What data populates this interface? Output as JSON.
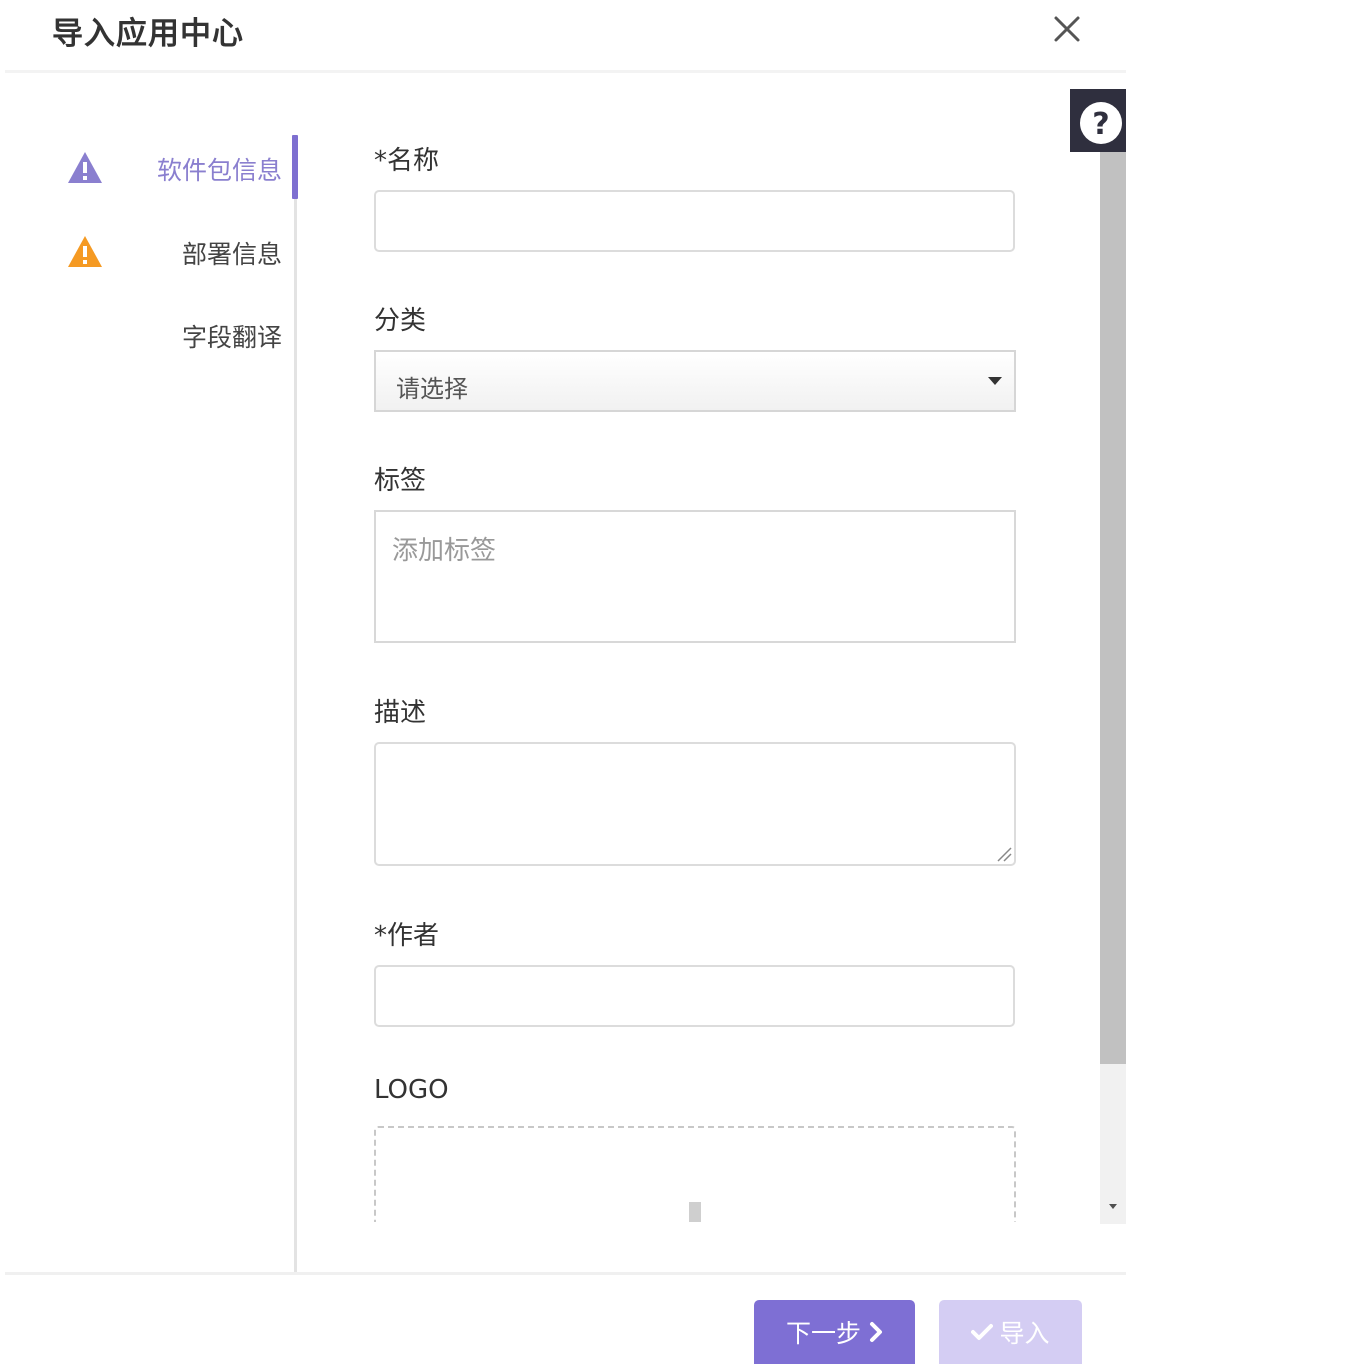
{
  "dialog": {
    "title": "导入应用中心"
  },
  "steps": [
    {
      "label": "软件包信息",
      "status": "warning",
      "active": true,
      "icon": "warning-icon",
      "icon_color": "#8a7fcf"
    },
    {
      "label": "部署信息",
      "status": "warning",
      "active": false,
      "icon": "warning-icon",
      "icon_color": "#f59a23"
    },
    {
      "label": "字段翻译",
      "status": "none",
      "active": false
    }
  ],
  "form": {
    "name": {
      "label": "*名称",
      "value": ""
    },
    "category": {
      "label": "分类",
      "selected": "请选择"
    },
    "tags": {
      "label": "标签",
      "placeholder": "添加标签"
    },
    "description": {
      "label": "描述",
      "value": ""
    },
    "author": {
      "label": "*作者",
      "value": ""
    },
    "logo": {
      "label": "LOGO"
    }
  },
  "help": {
    "icon": "help-icon",
    "glyph": "?"
  },
  "footer": {
    "next_label": "下一步",
    "import_label": "导入"
  },
  "colors": {
    "accent": "#7e6fd4",
    "accent_disabled": "#d4cdf3",
    "warning": "#f59a23"
  }
}
